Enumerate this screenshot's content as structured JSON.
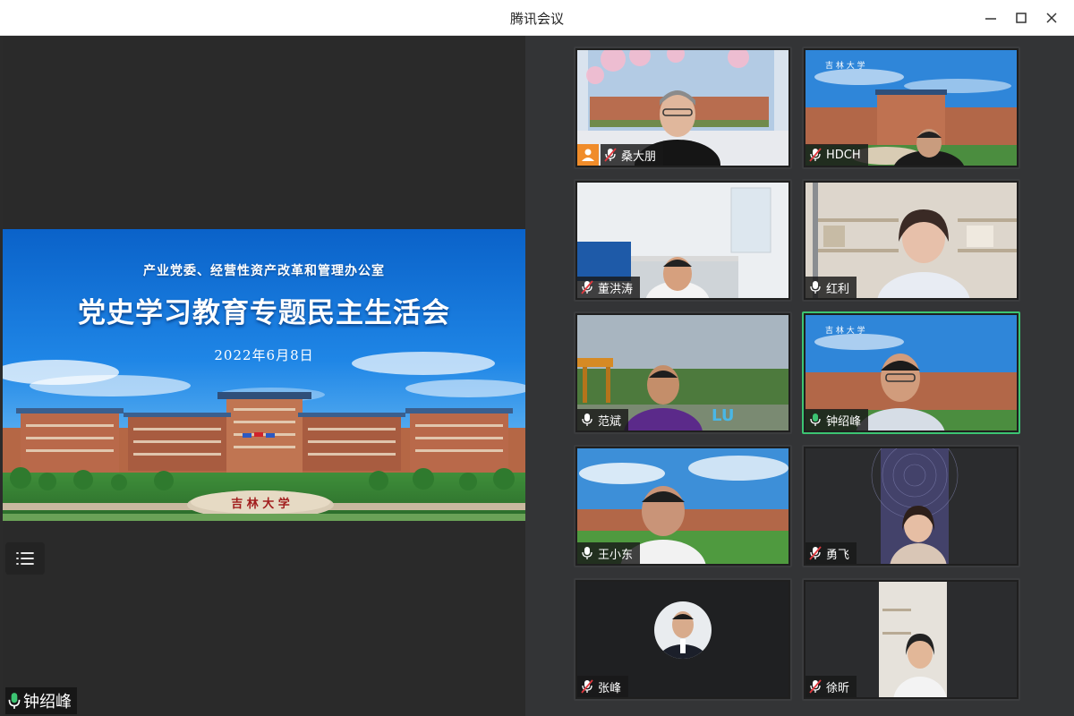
{
  "window": {
    "title": "腾讯会议"
  },
  "slide": {
    "org": "产业党委、经营性资产改革和管理办公室",
    "title": "党史学习教育专题民主生活会",
    "date": "2022年6月8日"
  },
  "main": {
    "speaker_name": "钟绍峰",
    "speaker_mic": "mic-on-icon"
  },
  "participants": [
    {
      "name": "桑大朋",
      "mic": "muted",
      "has_avatar_badge": true
    },
    {
      "name": "HDCH",
      "mic": "muted"
    },
    {
      "name": "董洪涛",
      "mic": "muted"
    },
    {
      "name": "红利",
      "mic": "on"
    },
    {
      "name": "范斌",
      "mic": "on"
    },
    {
      "name": "钟绍峰",
      "mic": "on",
      "speaking": true
    },
    {
      "name": "王小东",
      "mic": "on"
    },
    {
      "name": "勇飞",
      "mic": "muted"
    },
    {
      "name": "张峰",
      "mic": "muted"
    },
    {
      "name": "徐昕",
      "mic": "muted"
    }
  ],
  "colors": {
    "active_border": "#3cc472",
    "stage_bg": "#2b2b2b",
    "gutter_bg": "#333436",
    "badge_orange": "#f08c2a",
    "mute_red": "#e0383e"
  }
}
